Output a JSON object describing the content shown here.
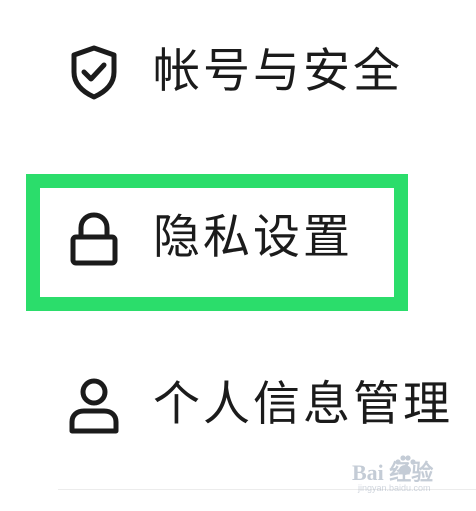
{
  "menu": {
    "items": [
      {
        "label": "帐号与安全",
        "icon": "shield-check-icon"
      },
      {
        "label": "隐私设置",
        "icon": "lock-icon"
      },
      {
        "label": "个人信息管理",
        "icon": "person-icon"
      }
    ]
  },
  "highlight": {
    "target": "隐私设置",
    "color": "#2bdd6b"
  },
  "colors": {
    "text": "#1b1b1b",
    "icon": "#1b1b1b",
    "background": "#ffffff"
  },
  "watermark": {
    "brand": "Bai 经验",
    "url": "jingyan.baidu.com"
  }
}
